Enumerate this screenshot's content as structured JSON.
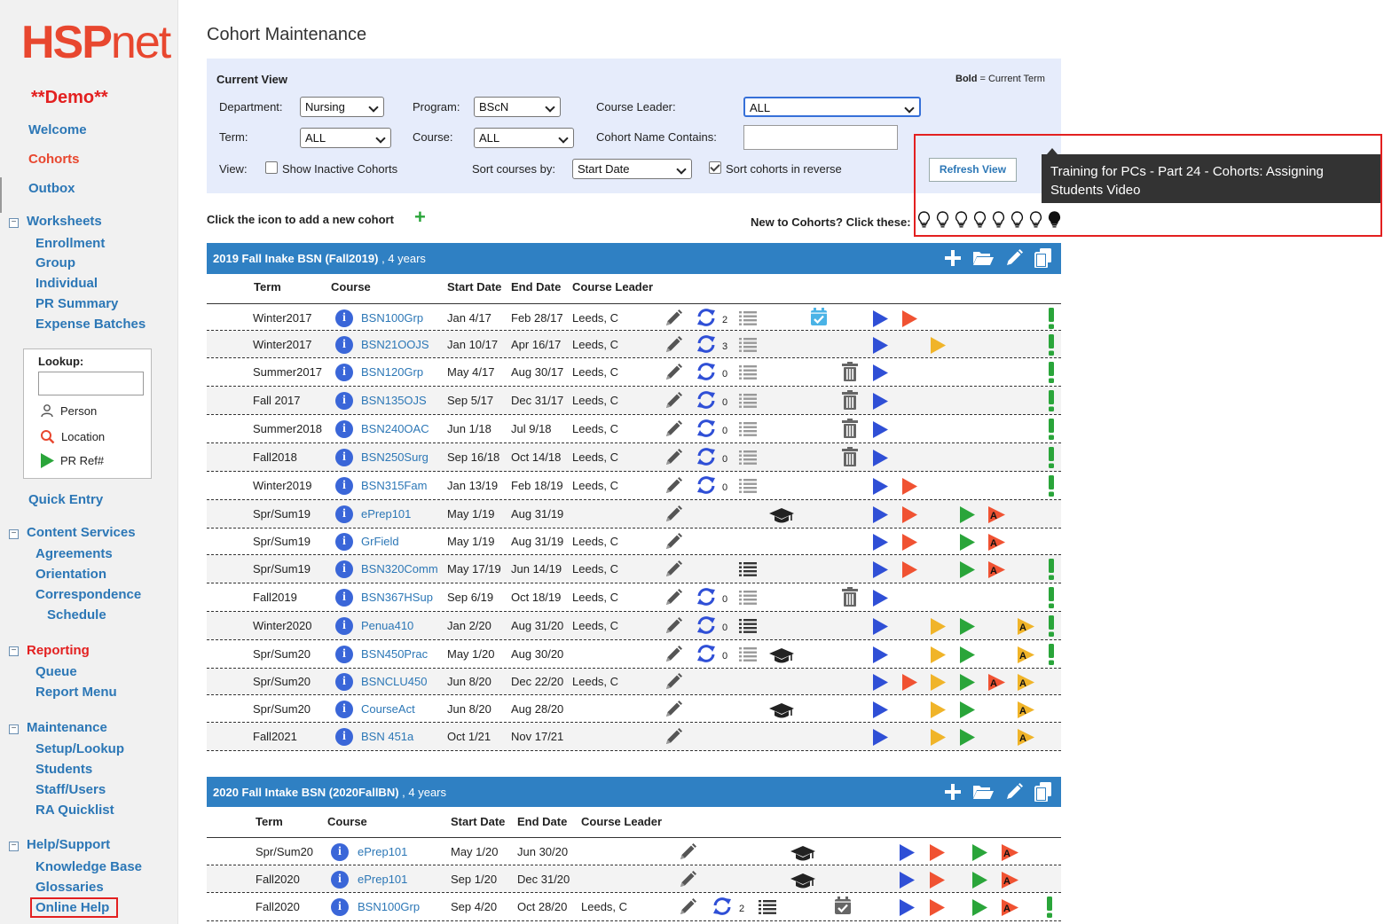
{
  "sidebar": {
    "logo_hsp": "HSP",
    "logo_net": "net",
    "demo": "**Demo**",
    "welcome": "Welcome",
    "cohorts": "Cohorts",
    "outbox": "Outbox",
    "worksheets": "Worksheets",
    "enrollment": "Enrollment",
    "group": "Group",
    "individual": "Individual",
    "pr_summary": "PR Summary",
    "expense_batches": "Expense Batches",
    "lookup_label": "Lookup:",
    "lookup_person": "Person",
    "lookup_location": "Location",
    "lookup_prref": "PR Ref#",
    "quick_entry": "Quick Entry",
    "content_services": "Content Services",
    "agreements": "Agreements",
    "orientation": "Orientation",
    "correspondence": "Correspondence",
    "schedule": "Schedule",
    "reporting": "Reporting",
    "queue": "Queue",
    "report_menu": "Report Menu",
    "maintenance": "Maintenance",
    "setup_lookup": "Setup/Lookup",
    "students": "Students",
    "staff_users": "Staff/Users",
    "ra_quicklist": "RA Quicklist",
    "help_support": "Help/Support",
    "knowledge_base": "Knowledge Base",
    "glossaries": "Glossaries",
    "online_help": "Online Help"
  },
  "page": {
    "title": "Cohort Maintenance",
    "current_view": "Current View",
    "bold_note_b": "Bold",
    "bold_note": " = Current Term",
    "department_label": "Department:",
    "department_value": "Nursing",
    "program_label": "Program:",
    "program_value": "BScN",
    "course_leader_label": "Course Leader:",
    "course_leader_value": "ALL",
    "term_label": "Term:",
    "term_value": "ALL",
    "course_label": "Course:",
    "course_value": "ALL",
    "name_contains_label": "Cohort Name Contains:",
    "view_label": "View:",
    "show_inactive": "Show Inactive Cohorts",
    "sort_by_label": "Sort courses by:",
    "sort_by_value": "Start Date",
    "sort_reverse": "Sort cohorts in reverse",
    "refresh": "Refresh View",
    "tooltip": "Training for PCs - Part 24 - Cohorts: Assigning Students Video",
    "add_text": "Click the icon to add a new cohort",
    "new_text": "New to Cohorts? Click these:"
  },
  "columns": {
    "term": "Term",
    "course": "Course",
    "start": "Start Date",
    "end": "End Date",
    "leader": "Course Leader"
  },
  "cohorts": [
    {
      "name": "2019 Fall Inake BSN (Fall2019)",
      "duration": ", 4 years",
      "rows": [
        {
          "term": "Winter2017",
          "course": "BSN100Grp",
          "start": "Jan 4/17",
          "end": "Feb 28/17",
          "leader": "Leeds, C",
          "count": "2"
        },
        {
          "term": "Winter2017",
          "course": "BSN21OOJS",
          "start": "Jan 10/17",
          "end": "Apr 16/17",
          "leader": "Leeds, C",
          "count": "3"
        },
        {
          "term": "Summer2017",
          "course": "BSN120Grp",
          "start": "May 4/17",
          "end": "Aug 30/17",
          "leader": "Leeds, C",
          "count": "0"
        },
        {
          "term": "Fall 2017",
          "course": "BSN135OJS",
          "start": "Sep 5/17",
          "end": "Dec 31/17",
          "leader": "Leeds, C",
          "count": "0"
        },
        {
          "term": "Summer2018",
          "course": "BSN240OAC",
          "start": "Jun 1/18",
          "end": "Jul 9/18",
          "leader": "Leeds, C",
          "count": "0"
        },
        {
          "term": "Fall2018",
          "course": "BSN250Surg",
          "start": "Sep 16/18",
          "end": "Oct 14/18",
          "leader": "Leeds, C",
          "count": "0"
        },
        {
          "term": "Winter2019",
          "course": "BSN315Fam",
          "start": "Jan 13/19",
          "end": "Feb 18/19",
          "leader": "Leeds, C",
          "count": "0"
        },
        {
          "term": "Spr/Sum19",
          "course": "ePrep101",
          "start": "May 1/19",
          "end": "Aug 31/19",
          "leader": "",
          "count": ""
        },
        {
          "term": "Spr/Sum19",
          "course": "GrField",
          "start": "May 1/19",
          "end": "Aug 31/19",
          "leader": "Leeds, C",
          "count": ""
        },
        {
          "term": "Spr/Sum19",
          "course": "BSN320Comm",
          "start": "May 17/19",
          "end": "Jun 14/19",
          "leader": "Leeds, C",
          "count": ""
        },
        {
          "term": "Fall2019",
          "course": "BSN367HSup",
          "start": "Sep 6/19",
          "end": "Oct 18/19",
          "leader": "Leeds, C",
          "count": "0"
        },
        {
          "term": "Winter2020",
          "course": "Penua410",
          "start": "Jan 2/20",
          "end": "Aug 31/20",
          "leader": "Leeds, C",
          "count": "0"
        },
        {
          "term": "Spr/Sum20",
          "course": "BSN450Prac",
          "start": "May 1/20",
          "end": "Aug 30/20",
          "leader": "",
          "count": "0"
        },
        {
          "term": "Spr/Sum20",
          "course": "BSNCLU450",
          "start": "Jun 8/20",
          "end": "Dec 22/20",
          "leader": "Leeds, C",
          "count": ""
        },
        {
          "term": "Spr/Sum20",
          "course": "CourseAct",
          "start": "Jun 8/20",
          "end": "Aug 28/20",
          "leader": "",
          "count": ""
        },
        {
          "term": "Fall2021",
          "course": "BSN 451a",
          "start": "Oct 1/21",
          "end": "Nov 17/21",
          "leader": "",
          "count": ""
        }
      ]
    },
    {
      "name": "2020 Fall Intake BSN (2020FallBN)",
      "duration": ", 4 years",
      "rows": [
        {
          "term": "Spr/Sum20",
          "course": "ePrep101",
          "start": "May 1/20",
          "end": "Jun 30/20",
          "leader": "",
          "count": ""
        },
        {
          "term": "Fall2020",
          "course": "ePrep101",
          "start": "Sep 1/20",
          "end": "Dec 31/20",
          "leader": "",
          "count": ""
        },
        {
          "term": "Fall2020",
          "course": "BSN100Grp",
          "start": "Sep 4/20",
          "end": "Oct 28/20",
          "leader": "Leeds, C",
          "count": "2"
        }
      ]
    }
  ],
  "colors": {
    "brand_red": "#e8472f",
    "link_blue": "#2c77b6",
    "header_blue": "#2f80c3",
    "play_blue": "#2f4fd6",
    "play_red": "#f05232",
    "play_yellow": "#f0b429",
    "play_green": "#2aa53a"
  }
}
